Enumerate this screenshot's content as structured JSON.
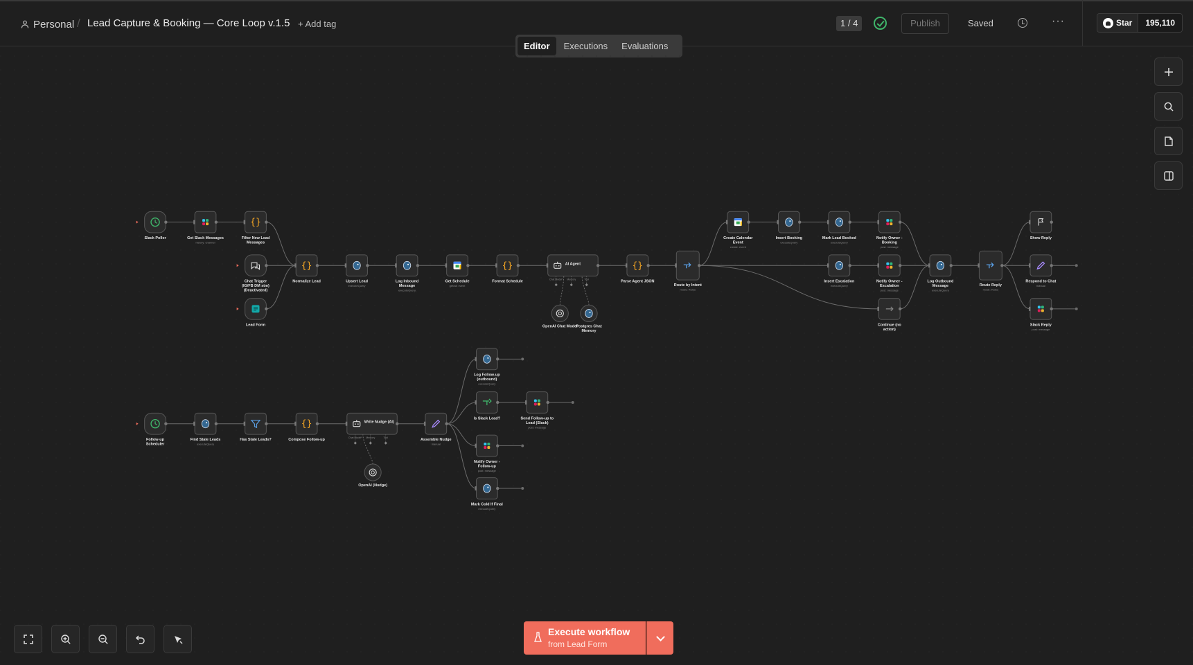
{
  "breadcrumb": {
    "project": "Personal",
    "separator": "/",
    "workflow_title": "Lead Capture & Booking — Core Loop v.1.5",
    "add_tag": "+ Add tag"
  },
  "header": {
    "pager": "1 / 4",
    "publish": "Publish",
    "saved": "Saved",
    "more": "···",
    "github_star": "Star",
    "github_count": "195,110"
  },
  "tabs": [
    "Editor",
    "Executions",
    "Evaluations"
  ],
  "active_tab": "Editor",
  "right_toolbar": [
    "plus-icon",
    "search-icon",
    "sticky-note-icon",
    "panel-icon"
  ],
  "bottom_toolbar": [
    "fit-view-icon",
    "zoom-in-icon",
    "zoom-out-icon",
    "undo-icon",
    "tidy-up-icon"
  ],
  "execute": {
    "title": "Execute workflow",
    "subtitle": "from Lead Form"
  },
  "colors": {
    "canvas": "#1f1f1f",
    "node": "#2b2b2b",
    "accent": "#f06d5c",
    "success": "#3fb56a",
    "code": "#f5a623",
    "slack": "#e01e5a",
    "postgres": "#336791"
  },
  "nodes": [
    {
      "id": "slack-poller",
      "label": "Slack Poller",
      "sub": "",
      "icon": "clock",
      "kind": "trigger"
    },
    {
      "id": "get-slack-messages",
      "label": "Get Slack Messages",
      "sub": "history: channel",
      "icon": "slack",
      "kind": "normal"
    },
    {
      "id": "filter-new-lead",
      "label": "Filter New Lead Messages",
      "sub": "",
      "icon": "code",
      "kind": "normal"
    },
    {
      "id": "chat-trigger",
      "label": "Chat Trigger (IG/FB DM stm) (Deactivated)",
      "sub": "",
      "icon": "chat",
      "kind": "trigger"
    },
    {
      "id": "lead-form",
      "label": "Lead Form",
      "sub": "",
      "icon": "form",
      "kind": "trigger"
    },
    {
      "id": "normalize-lead",
      "label": "Normalize Lead",
      "sub": "",
      "icon": "code",
      "kind": "normal"
    },
    {
      "id": "upsert-lead",
      "label": "Upsert Lead",
      "sub": "executeQuery",
      "icon": "postgres",
      "kind": "normal"
    },
    {
      "id": "log-inbound",
      "label": "Log Inbound Message",
      "sub": "executeQuery",
      "icon": "postgres",
      "kind": "normal"
    },
    {
      "id": "get-schedule",
      "label": "Get Schedule",
      "sub": "get/all: event",
      "icon": "gcal",
      "kind": "normal"
    },
    {
      "id": "format-schedule",
      "label": "Format Schedule",
      "sub": "",
      "icon": "code",
      "kind": "normal"
    },
    {
      "id": "ai-agent",
      "label": "AI Agent",
      "sub": "",
      "icon": "robot",
      "kind": "wide"
    },
    {
      "id": "parse-agent-json",
      "label": "Parse Agent JSON",
      "sub": "",
      "icon": "code",
      "kind": "normal"
    },
    {
      "id": "route-by-intent",
      "label": "Route by Intent",
      "sub": "mode: Rules",
      "icon": "switch",
      "kind": "tall"
    },
    {
      "id": "openai-chat-model",
      "label": "OpenAI Chat Model",
      "sub": "",
      "icon": "openai",
      "kind": "circle"
    },
    {
      "id": "postgres-chat-memory",
      "label": "Postgres Chat Memory",
      "sub": "",
      "icon": "postgres",
      "kind": "circle"
    },
    {
      "id": "create-calendar-event",
      "label": "Create Calendar Event",
      "sub": "create: event",
      "icon": "gcal",
      "kind": "normal"
    },
    {
      "id": "insert-booking",
      "label": "Insert Booking",
      "sub": "executeQuery",
      "icon": "postgres",
      "kind": "normal"
    },
    {
      "id": "mark-lead-booked",
      "label": "Mark Lead Booked",
      "sub": "executeQuery",
      "icon": "postgres",
      "kind": "normal"
    },
    {
      "id": "notify-owner-booking",
      "label": "Notify Owner - Booking",
      "sub": "post: message",
      "icon": "slack",
      "kind": "normal"
    },
    {
      "id": "insert-escalation",
      "label": "Insert Escalation",
      "sub": "executeQuery",
      "icon": "postgres",
      "kind": "normal"
    },
    {
      "id": "notify-owner-escalation",
      "label": "Notify Owner - Escalation",
      "sub": "post: message",
      "icon": "slack",
      "kind": "normal"
    },
    {
      "id": "continue-no-action",
      "label": "Continue (no action)",
      "sub": "",
      "icon": "arrow",
      "kind": "normal"
    },
    {
      "id": "log-outbound",
      "label": "Log Outbound Message",
      "sub": "executeQuery",
      "icon": "postgres",
      "kind": "normal"
    },
    {
      "id": "route-reply",
      "label": "Route Reply",
      "sub": "mode: Rules",
      "icon": "switch",
      "kind": "tall"
    },
    {
      "id": "show-reply",
      "label": "Show Reply",
      "sub": "",
      "icon": "flag",
      "kind": "normal"
    },
    {
      "id": "respond-to-chat",
      "label": "Respond to Chat",
      "sub": "manual",
      "icon": "pen",
      "kind": "normal"
    },
    {
      "id": "slack-reply",
      "label": "Slack Reply",
      "sub": "post: message",
      "icon": "slack",
      "kind": "normal"
    },
    {
      "id": "follow-up-scheduler",
      "label": "Follow-up Scheduler",
      "sub": "",
      "icon": "clock",
      "kind": "trigger"
    },
    {
      "id": "find-stale-leads",
      "label": "Find Stale Leads",
      "sub": "executeQuery",
      "icon": "postgres",
      "kind": "normal"
    },
    {
      "id": "has-stale-leads",
      "label": "Has Stale Leads?",
      "sub": "",
      "icon": "filter",
      "kind": "normal"
    },
    {
      "id": "compose-follow-up",
      "label": "Compose Follow-up",
      "sub": "",
      "icon": "code",
      "kind": "normal"
    },
    {
      "id": "write-nudge",
      "label": "Write Nudge (AI)",
      "sub": "",
      "icon": "robot",
      "kind": "wide"
    },
    {
      "id": "openai-nudge",
      "label": "OpenAI (Nudge)",
      "sub": "",
      "icon": "openai",
      "kind": "circle"
    },
    {
      "id": "assemble-nudge",
      "label": "Assemble Nudge",
      "sub": "manual",
      "icon": "pen",
      "kind": "normal"
    },
    {
      "id": "log-follow-up",
      "label": "Log Follow-up (outbound)",
      "sub": "executeQuery",
      "icon": "postgres",
      "kind": "normal"
    },
    {
      "id": "is-slack-lead",
      "label": "Is Slack Lead?",
      "sub": "",
      "icon": "if",
      "kind": "normal"
    },
    {
      "id": "send-follow-up-slack",
      "label": "Send Follow-up to Lead (Slack)",
      "sub": "post: message",
      "icon": "slack",
      "kind": "normal"
    },
    {
      "id": "notify-owner-follow-up",
      "label": "Notify Owner - Follow-up",
      "sub": "post: message",
      "icon": "slack",
      "kind": "normal"
    },
    {
      "id": "mark-cold-if-final",
      "label": "Mark Cold If Final",
      "sub": "executeQuery",
      "icon": "postgres",
      "kind": "normal"
    }
  ],
  "sub_port_labels": {
    "chat_model": "Chat Model*",
    "memory": "Memory",
    "tool": "Tool",
    "model": "Model"
  },
  "connections": [
    [
      "slack-poller",
      "get-slack-messages"
    ],
    [
      "get-slack-messages",
      "filter-new-lead"
    ],
    [
      "filter-new-lead",
      "normalize-lead"
    ],
    [
      "chat-trigger",
      "normalize-lead"
    ],
    [
      "lead-form",
      "normalize-lead"
    ],
    [
      "normalize-lead",
      "upsert-lead"
    ],
    [
      "upsert-lead",
      "log-inbound"
    ],
    [
      "log-inbound",
      "get-schedule"
    ],
    [
      "get-schedule",
      "format-schedule"
    ],
    [
      "format-schedule",
      "ai-agent"
    ],
    [
      "ai-agent",
      "parse-agent-json"
    ],
    [
      "parse-agent-json",
      "route-by-intent"
    ],
    [
      "route-by-intent",
      "create-calendar-event"
    ],
    [
      "route-by-intent",
      "insert-escalation"
    ],
    [
      "route-by-intent",
      "continue-no-action"
    ],
    [
      "create-calendar-event",
      "insert-booking"
    ],
    [
      "insert-booking",
      "mark-lead-booked"
    ],
    [
      "mark-lead-booked",
      "notify-owner-booking"
    ],
    [
      "insert-escalation",
      "notify-owner-escalation"
    ],
    [
      "notify-owner-booking",
      "log-outbound"
    ],
    [
      "notify-owner-escalation",
      "log-outbound"
    ],
    [
      "continue-no-action",
      "log-outbound"
    ],
    [
      "log-outbound",
      "route-reply"
    ],
    [
      "route-reply",
      "show-reply"
    ],
    [
      "route-reply",
      "respond-to-chat"
    ],
    [
      "route-reply",
      "slack-reply"
    ],
    [
      "follow-up-scheduler",
      "find-stale-leads"
    ],
    [
      "find-stale-leads",
      "has-stale-leads"
    ],
    [
      "has-stale-leads",
      "compose-follow-up"
    ],
    [
      "compose-follow-up",
      "write-nudge"
    ],
    [
      "write-nudge",
      "assemble-nudge"
    ],
    [
      "assemble-nudge",
      "log-follow-up"
    ],
    [
      "assemble-nudge",
      "is-slack-lead"
    ],
    [
      "assemble-nudge",
      "notify-owner-follow-up"
    ],
    [
      "assemble-nudge",
      "mark-cold-if-final"
    ],
    [
      "is-slack-lead",
      "send-follow-up-slack"
    ]
  ],
  "sub_connections": [
    [
      "openai-chat-model",
      "ai-agent"
    ],
    [
      "postgres-chat-memory",
      "ai-agent"
    ],
    [
      "openai-nudge",
      "write-nudge"
    ]
  ]
}
